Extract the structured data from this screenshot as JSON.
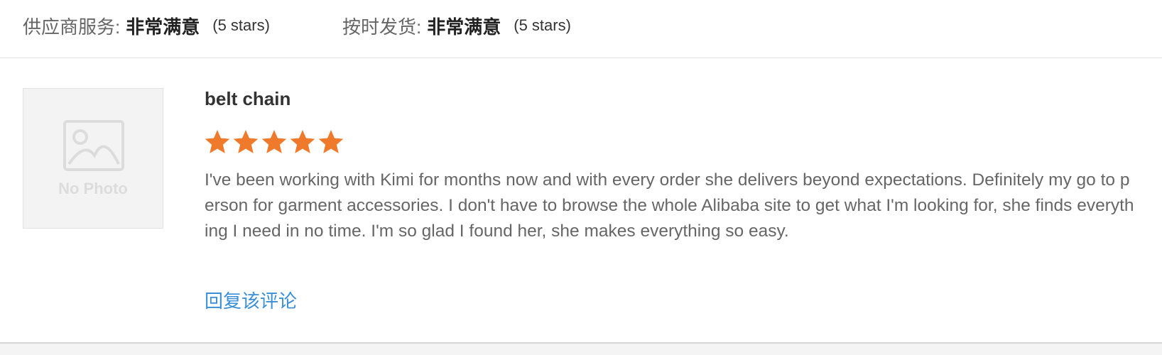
{
  "ratings": [
    {
      "label": "供应商服务:",
      "value": "非常满意",
      "stars_text": "(5 stars)"
    },
    {
      "label": "按时发货:",
      "value": "非常满意",
      "stars_text": "(5 stars)"
    }
  ],
  "review": {
    "photo_placeholder": "No Photo",
    "product_title": "belt chain",
    "star_rating": 5,
    "star_max": 5,
    "star_color": "#f07a2b",
    "text": "I've been working with Kimi for months now and with every order she delivers beyond expectations. Definitely my go to person for garment accessories. I don't have to browse the whole Alibaba site to get what I'm looking for, she finds everything I need in no time. I'm so glad I found her, she makes everything so easy.",
    "reply_label": "回复该评论",
    "link_color": "#3a8fd6"
  }
}
